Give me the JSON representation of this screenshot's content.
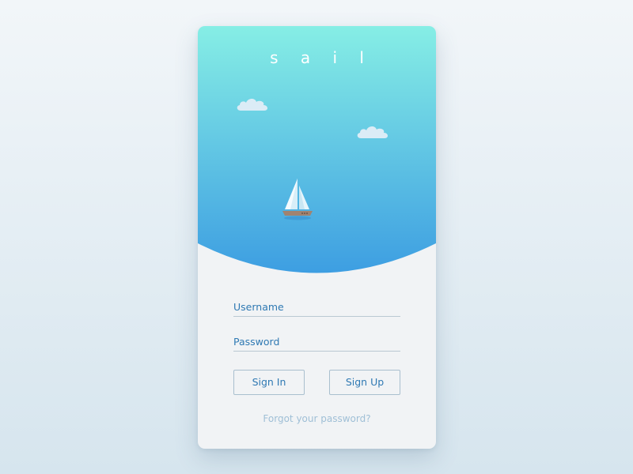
{
  "app": {
    "brand": "s a i l"
  },
  "illustration": {
    "icons": [
      "cloud-icon",
      "cloud-icon",
      "sailboat-icon"
    ]
  },
  "form": {
    "username_placeholder": "Username",
    "password_placeholder": "Password",
    "signin_label": "Sign In",
    "signup_label": "Sign Up",
    "forgot_label": "Forgot your password?"
  },
  "colors": {
    "sky_top": "#86eee5",
    "sky_bottom": "#3d9ee2",
    "accent": "#2f79b3",
    "card_bg": "#f1f3f5",
    "line": "#b9c8d2",
    "muted_link": "#9fbfd6"
  }
}
